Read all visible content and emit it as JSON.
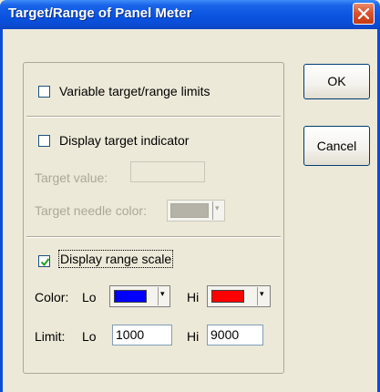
{
  "window": {
    "title": "Target/Range of Panel Meter"
  },
  "options": {
    "variable_limits": {
      "label": "Variable target/range limits",
      "checked": false
    },
    "display_target": {
      "label": "Display target indicator",
      "checked": false
    },
    "target_value": {
      "label": "Target value:",
      "value": ""
    },
    "target_needle_color": {
      "label": "Target needle color:",
      "color": "#b5b3a8"
    },
    "display_range": {
      "label": "Display range scale",
      "checked": true
    }
  },
  "color_row": {
    "label": "Color:",
    "lo_label": "Lo",
    "lo_color": "#0000ff",
    "hi_label": "Hi",
    "hi_color": "#ff0000"
  },
  "limit_row": {
    "label": "Limit:",
    "lo_label": "Lo",
    "lo_value": "1000",
    "hi_label": "Hi",
    "hi_value": "9000"
  },
  "buttons": {
    "ok": "OK",
    "cancel": "Cancel"
  }
}
